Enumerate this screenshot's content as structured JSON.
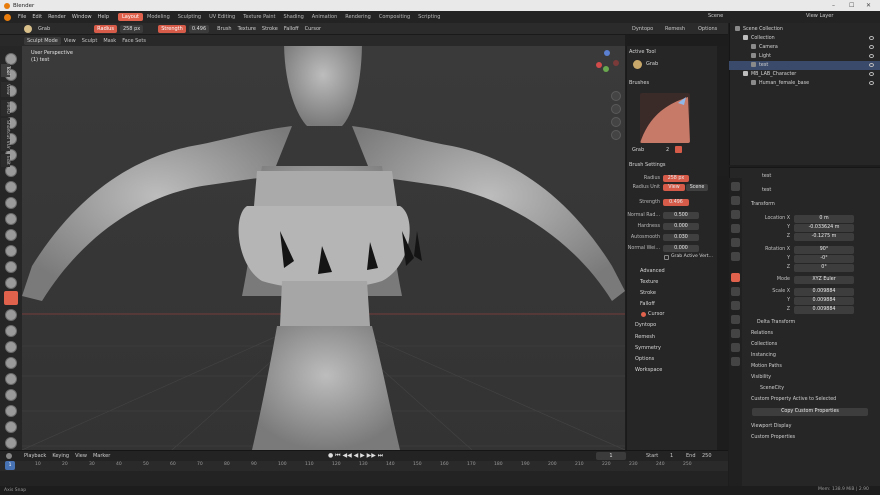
{
  "window": {
    "title": "Blender",
    "controls": [
      "–",
      "☐",
      "✕"
    ]
  },
  "menu": {
    "items": [
      "File",
      "Edit",
      "Render",
      "Window",
      "Help"
    ],
    "workspaces": [
      "Layout",
      "Modeling",
      "Sculpting",
      "UV Editing",
      "Texture Paint",
      "Shading",
      "Animation",
      "Rendering",
      "Compositing",
      "Scripting"
    ],
    "scene_label": "Scene",
    "view_layer_label": "View Layer"
  },
  "tool_header": {
    "brush_name": "Grab",
    "radius_label": "Radius",
    "radius_value": "258 px",
    "strength_label": "Strength",
    "strength_value": "0.496",
    "brush_menu": "Brush",
    "texture_menu": "Texture",
    "stroke_menu": "Stroke",
    "falloff_menu": "Falloff",
    "cursor_menu": "Cursor",
    "dyntopo_label": "Dyntopo",
    "remesh_label": "Remesh",
    "options_label": "Options"
  },
  "viewport_header": {
    "mode": "Sculpt Mode",
    "menus": [
      "View",
      "Sculpt",
      "Mask",
      "Face Sets"
    ]
  },
  "viewport": {
    "perspective": "User Perspective",
    "object": "(1) test",
    "background_color": "#3a3a3a"
  },
  "npanel": {
    "tabs": [
      "Tool",
      "View",
      "MIRO",
      "Shortcut VUr",
      "Edit"
    ],
    "active_tool_header": "Active Tool",
    "active_tool_name": "Grab",
    "brushes_header": "Brushes",
    "brush_name": "Grab",
    "brush_users": "2",
    "brush_settings_header": "Brush Settings",
    "radius_label": "Radius",
    "radius_value": "258 px",
    "radius_unit_label": "Radius Unit",
    "radius_unit_options": [
      "View",
      "Scene"
    ],
    "strength_label": "Strength",
    "strength_value": "0.496",
    "normal_radius_label": "Normal Rad...",
    "normal_radius_value": "0.500",
    "hardness_label": "Hardness",
    "hardness_value": "0.000",
    "autosmooth_label": "Autosmooth",
    "autosmooth_value": "0.030",
    "normal_weight_label": "Normal Wei...",
    "normal_weight_value": "0.000",
    "grab_active_vertex": "Grab Active Vert...",
    "subpanels": [
      "Advanced",
      "Texture",
      "Stroke",
      "Falloff",
      "Cursor"
    ],
    "panels": [
      "Dyntopo",
      "Remesh",
      "Symmetry",
      "Options",
      "Workspace"
    ]
  },
  "toolbar": {
    "accent": "#e0624d"
  },
  "timeline": {
    "playback": "Playback",
    "keying": "Keying",
    "view": "View",
    "marker": "Marker",
    "current_frame": "1",
    "start_label": "Start",
    "start_value": "1",
    "end_label": "End",
    "end_value": "250",
    "ticks": [
      "0",
      "10",
      "20",
      "30",
      "40",
      "50",
      "60",
      "70",
      "80",
      "90",
      "100",
      "110",
      "120",
      "130",
      "140",
      "150",
      "160",
      "170",
      "180",
      "190",
      "200",
      "210",
      "220",
      "230",
      "240",
      "250"
    ]
  },
  "outliner": {
    "rows": [
      {
        "label": "Scene Collection",
        "indent": 0,
        "selected": false
      },
      {
        "label": "Collection",
        "indent": 1,
        "selected": false
      },
      {
        "label": "Camera",
        "indent": 2,
        "selected": false
      },
      {
        "label": "Light",
        "indent": 2,
        "selected": false
      },
      {
        "label": "test",
        "indent": 2,
        "selected": true
      },
      {
        "label": "MB_LAB_Character",
        "indent": 1,
        "selected": false
      },
      {
        "label": "Human_female_base",
        "indent": 2,
        "selected": false
      }
    ]
  },
  "properties": {
    "object_name": "test",
    "data_name": "test",
    "transform_header": "Transform",
    "location_label": "Location X",
    "location": [
      "0 m",
      "-0.033624 m",
      "-0.1275 m"
    ],
    "rotation_label": "Rotation X",
    "rotation": [
      "90°",
      "-0°",
      "0°"
    ],
    "mode_label": "Mode",
    "mode_value": "XYZ Euler",
    "scale_label": "Scale X",
    "scale": [
      "0.009884",
      "0.009884",
      "0.009884"
    ],
    "axis_y": "Y",
    "axis_z": "Z",
    "delta_transform": "Delta Transform",
    "sections": [
      "Relations",
      "Collections",
      "Instancing",
      "Motion Paths",
      "Visibility"
    ],
    "scenecity": "SceneCity",
    "custom_active": "Custom Property Active to Selected",
    "copy_custom": "Copy Custom Properties",
    "viewport_display": "Viewport Display",
    "custom_properties": "Custom Properties"
  },
  "statusbar": {
    "left": "Axis Snap",
    "right": "Mem: 138.9 MiB | 2.90"
  }
}
